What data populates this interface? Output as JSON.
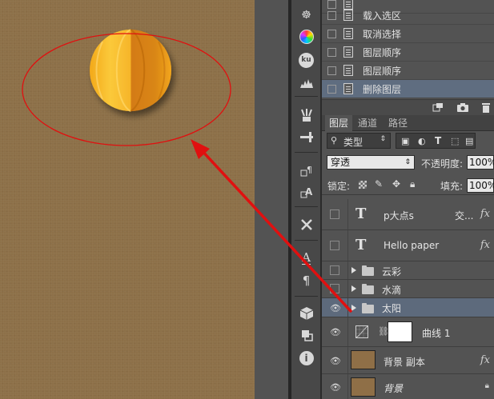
{
  "history": {
    "items": [
      {
        "label": ""
      },
      {
        "label": "载入选区"
      },
      {
        "label": "取消选择"
      },
      {
        "label": "图层顺序"
      },
      {
        "label": "图层顺序"
      },
      {
        "label": "删除图层",
        "active": true
      }
    ]
  },
  "tools": {
    "icons": [
      "ship-wheel-icon",
      "color-wheel-icon",
      "kuler-icon",
      "histogram-icon",
      "brush-presets-icon",
      "brush-icon",
      "paragraph-clone-icon",
      "character-clone-icon",
      "tools-preset-icon",
      "character-icon",
      "paragraph-icon",
      "3d-cube-icon",
      "3d-object-icon",
      "info-icon"
    ],
    "kuler_text": "ku",
    "char_text": "A",
    "para_text": "¶",
    "info_text": "i"
  },
  "layers_panel": {
    "tabs": [
      "图层",
      "通道",
      "路径"
    ],
    "active_tab": "图层",
    "filter_label": "类型",
    "blend_mode": "穿透",
    "opacity_label": "不透明度:",
    "opacity_value": "100%",
    "lock_label": "锁定:",
    "fill_label": "填充:",
    "fill_value": "100%"
  },
  "layers": [
    {
      "name": "p大点s",
      "kind": "text",
      "extra": "交...",
      "fx": "fx",
      "visible": false
    },
    {
      "name": "Hello paper",
      "kind": "text",
      "fx": "fx",
      "visible": false
    },
    {
      "name": "云彩",
      "kind": "group",
      "visible": false
    },
    {
      "name": "水滴",
      "kind": "group",
      "visible": false
    },
    {
      "name": "太阳",
      "kind": "group",
      "visible": true,
      "selected": true
    },
    {
      "name": "曲线 1",
      "kind": "adjustment",
      "visible": true
    },
    {
      "name": "背景 副本",
      "kind": "pixel",
      "fx": "fx",
      "visible": true
    },
    {
      "name": "背景",
      "kind": "background",
      "visible": true,
      "locked": true
    }
  ],
  "colors": {
    "canvas_bg": "#8d7048",
    "sun_light": "#f9c030",
    "sun_dark": "#d27a10",
    "annotation": "#e01010",
    "thumb_brown": "#8f6f47",
    "selected_row": "#5d6a7c"
  },
  "icons": {
    "eye": "eye-icon",
    "text_layer": "text-layer-icon",
    "folder": "folder-icon",
    "curves": "curves-icon",
    "chain": "chain-link-icon",
    "lock": "lock-icon",
    "fx": "fx-icon"
  }
}
